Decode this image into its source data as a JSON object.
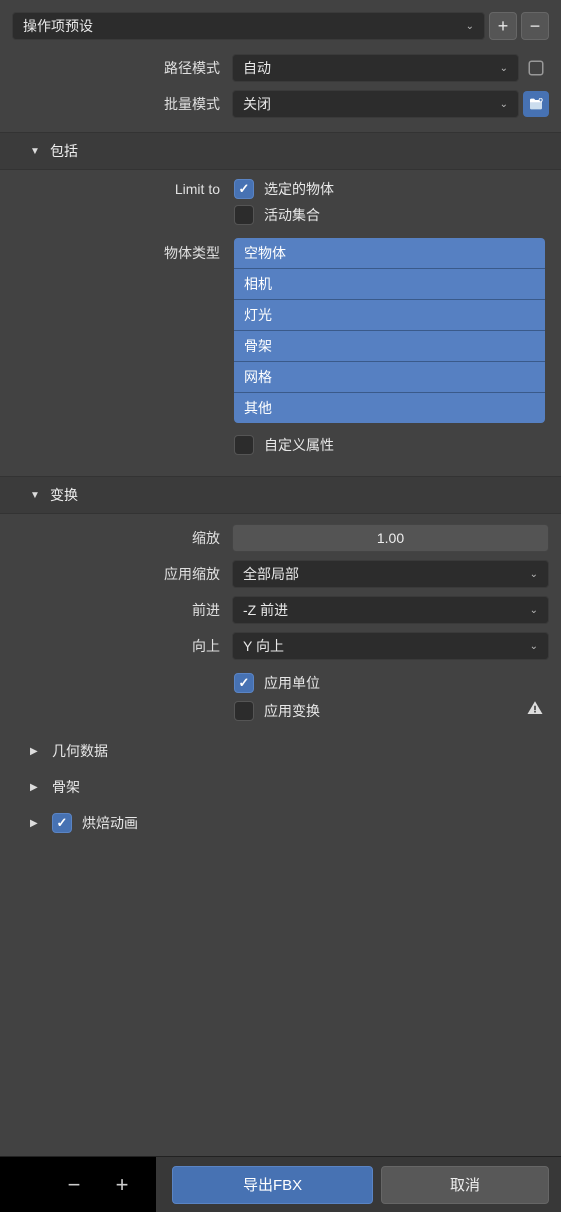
{
  "preset": {
    "label": "操作项预设"
  },
  "path_mode": {
    "label": "路径模式",
    "value": "自动"
  },
  "batch_mode": {
    "label": "批量模式",
    "value": "关闭"
  },
  "include": {
    "title": "包括",
    "limit_to_label": "Limit to",
    "selected_objects": {
      "label": "选定的物体",
      "checked": true
    },
    "active_collection": {
      "label": "活动集合",
      "checked": false
    },
    "object_types_label": "物体类型",
    "object_types": [
      "空物体",
      "相机",
      "灯光",
      "骨架",
      "网格",
      "其他"
    ],
    "custom_props": {
      "label": "自定义属性",
      "checked": false
    }
  },
  "transform": {
    "title": "变换",
    "scale": {
      "label": "缩放",
      "value": "1.00"
    },
    "apply_scale": {
      "label": "应用缩放",
      "value": "全部局部"
    },
    "forward": {
      "label": "前进",
      "value": "-Z 前进"
    },
    "up": {
      "label": "向上",
      "value": "Y 向上"
    },
    "apply_unit": {
      "label": "应用单位",
      "checked": true
    },
    "apply_transform": {
      "label": "应用变换",
      "checked": false
    }
  },
  "geometry": {
    "title": "几何数据"
  },
  "armature": {
    "title": "骨架"
  },
  "bake_anim": {
    "title": "烘焙动画",
    "checked": true
  },
  "footer": {
    "export_label": "导出FBX",
    "cancel_label": "取消"
  }
}
